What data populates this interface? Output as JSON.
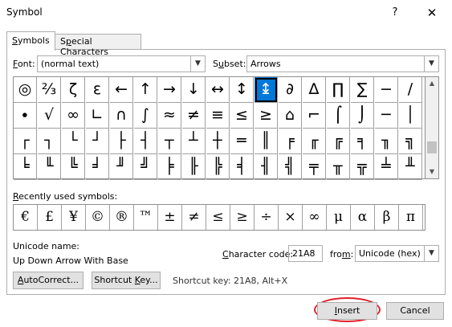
{
  "window": {
    "title": "Symbol",
    "help_glyph": "?",
    "close_glyph": "✕"
  },
  "tabs": [
    {
      "label_key": "S",
      "label_rest": "ymbols"
    },
    {
      "label_key": "P",
      "label_rest": "Special Characters",
      "label_pre": ""
    }
  ],
  "font_row": {
    "label_key": "F",
    "label_rest": "ont:",
    "value": "(normal text)",
    "subset_label_pre": "S",
    "subset_label_key": "u",
    "subset_label_rest": "bset:",
    "subset_value": "Arrows"
  },
  "grid": {
    "selected_index": 10,
    "rows": [
      [
        "◎",
        "⅔",
        "ζ",
        "ε",
        "←",
        "↑",
        "→",
        "↓",
        "↔",
        "↕",
        "↨",
        "∂",
        "∆",
        "∏",
        "∑",
        "−",
        "∕"
      ],
      [
        "∙",
        "√",
        "∞",
        "∟",
        "∩",
        "∫",
        "≈",
        "≠",
        "≡",
        "≤",
        "≥",
        "⌂",
        "⌐",
        "⌠",
        "⌡",
        "─",
        "│"
      ],
      [
        "┌",
        "┐",
        "└",
        "┘",
        "├",
        "┤",
        "┬",
        "┴",
        "┼",
        "═",
        "║",
        "╒",
        "╓",
        "╔",
        "╕",
        "╖",
        "╗"
      ],
      [
        "╘",
        "╙",
        "╚",
        "╛",
        "╜",
        "╝",
        "╞",
        "╟",
        "╠",
        "╡",
        "╢",
        "╣",
        "╤",
        "╥",
        "╦",
        "╧",
        "╨"
      ]
    ]
  },
  "recent": {
    "label_pre": "",
    "label_key": "R",
    "label_rest": "ecently used symbols:",
    "symbols": [
      "€",
      "£",
      "¥",
      "©",
      "®",
      "™",
      "±",
      "≠",
      "≤",
      "≥",
      "÷",
      "×",
      "∞",
      "μ",
      "α",
      "β",
      "π"
    ]
  },
  "unicode": {
    "name_label": "Unicode name:",
    "name_value": "Up Down Arrow With Base",
    "charcode_label_key": "C",
    "charcode_label_rest": "haracter code:",
    "charcode_value": "21A8",
    "from_label_pre": "fro",
    "from_label_key": "m",
    "from_label_rest": ":",
    "from_value": "Unicode (hex)"
  },
  "buttons": {
    "autocorrect_key": "A",
    "autocorrect_rest": "utoCorrect...",
    "shortcut_pre": "Shortcut ",
    "shortcut_key": "K",
    "shortcut_rest": "ey...",
    "shortcut_text": "Shortcut key: 21A8, Alt+X",
    "insert_key": "I",
    "insert_rest": "nsert",
    "cancel": "Cancel"
  },
  "colors": {
    "selection": "#0078d7",
    "highlight_ring": "#e0202a"
  }
}
